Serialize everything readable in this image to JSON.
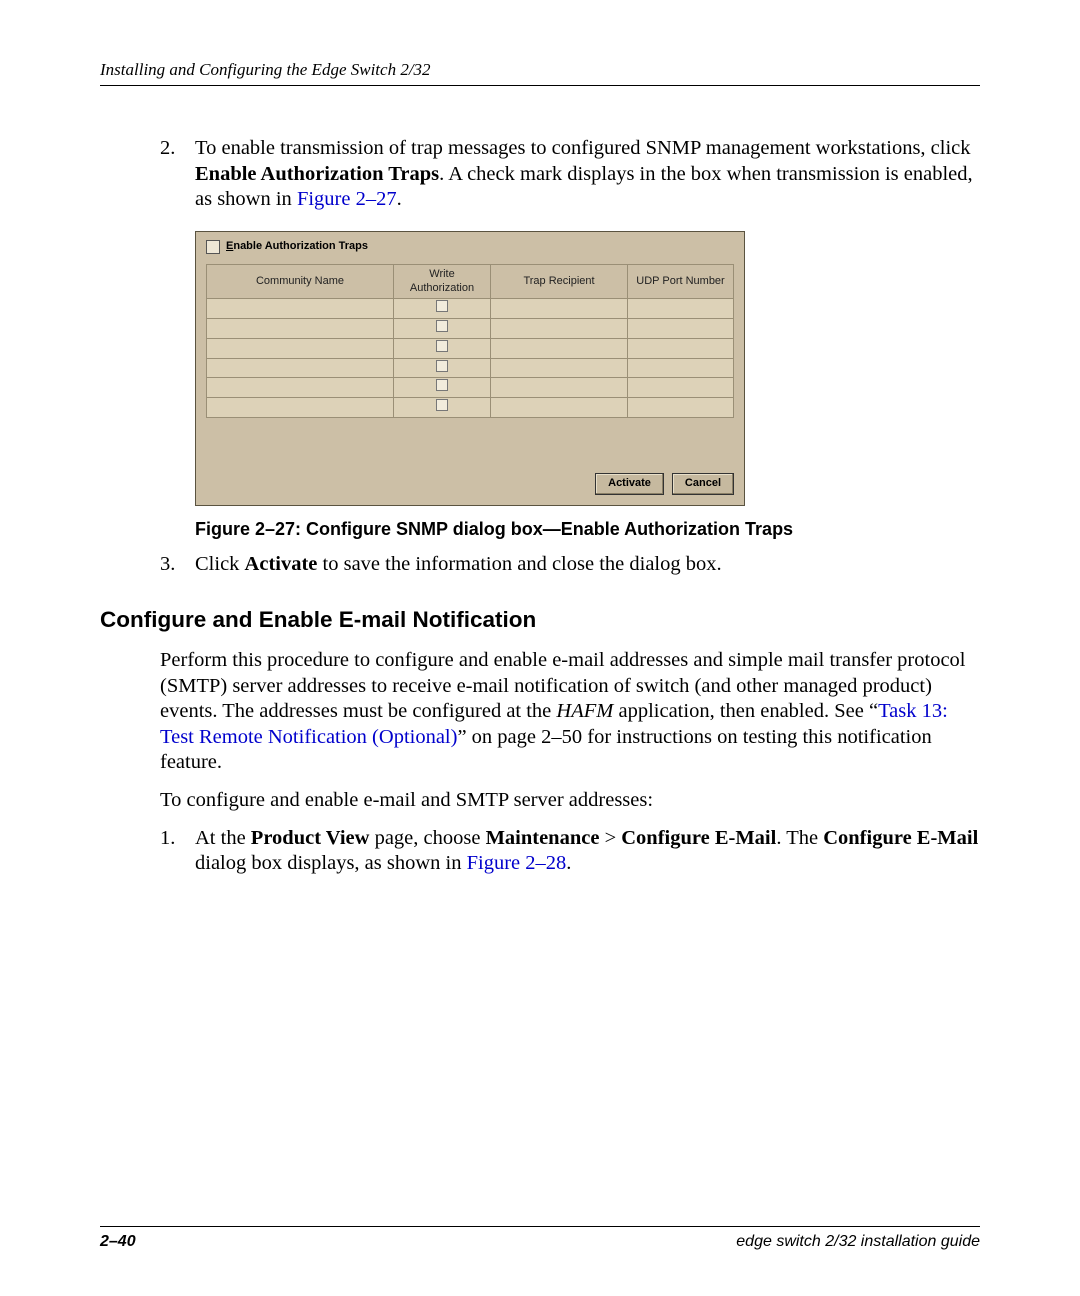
{
  "header": {
    "title": "Installing and Configuring the Edge Switch 2/32"
  },
  "step2": {
    "num": "2.",
    "pre": "To enable transmission of trap messages to configured SNMP management workstations, click ",
    "bold": "Enable Authorization Traps",
    "post": ". A check mark displays in the box when transmission is enabled, as shown in ",
    "link": "Figure 2–27",
    "end": "."
  },
  "dialog": {
    "check_label_E": "E",
    "check_label_rest": "nable Authorization Traps",
    "cols": {
      "community": "Community Name",
      "write": "Write Authorization",
      "trap": "Trap Recipient",
      "udp": "UDP Port Number"
    },
    "btn_activate": "Activate",
    "btn_cancel": "Cancel"
  },
  "figcaption": "Figure 2–27:  Configure SNMP dialog box—Enable Authorization Traps",
  "step3": {
    "num": "3.",
    "pre": "Click ",
    "bold": "Activate",
    "post": " to save the information and close the dialog box."
  },
  "h2": "Configure and Enable E-mail Notification",
  "para1": {
    "a": "Perform this procedure to configure and enable e-mail addresses and simple mail transfer protocol (SMTP) server addresses to receive e-mail notification of switch (and other managed product) events. The addresses must be configured at the ",
    "i": "HAFM",
    "b": " application, then enabled. See “",
    "link": "Task 13: Test Remote Notification (Optional)",
    "c": "” on page 2–50 for instructions on testing this notification feature."
  },
  "para2": "To configure and enable e-mail and SMTP server addresses:",
  "step1b": {
    "num": "1.",
    "a": "At the ",
    "b1": "Product View",
    "b": " page, choose ",
    "b2": "Maintenance",
    "gt": " > ",
    "b3": "Configure E-Mail",
    "c": ". The ",
    "b4": "Configure E-Mail",
    "d": " dialog box displays, as shown in ",
    "link": "Figure 2–28",
    "e": "."
  },
  "footer": {
    "page": "2–40",
    "title": "edge switch 2/32 installation guide"
  }
}
